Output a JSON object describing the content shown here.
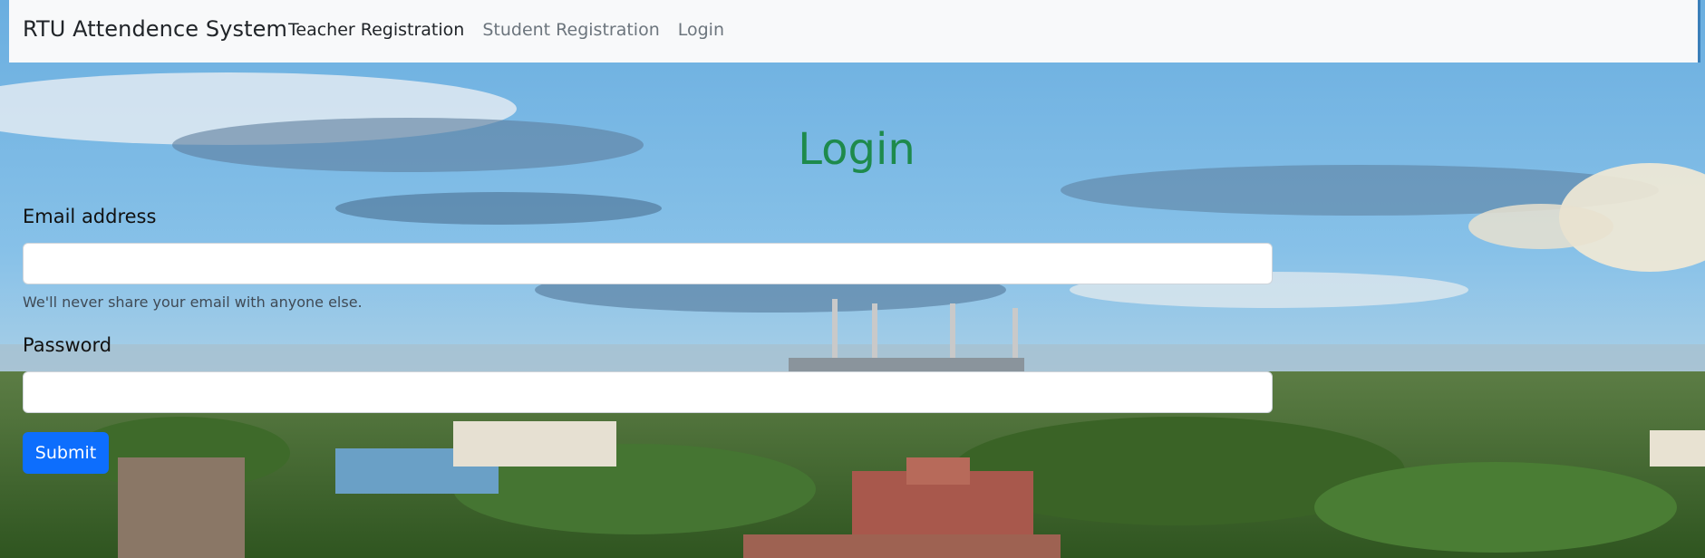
{
  "navbar": {
    "brand": "RTU Attendence System",
    "links": [
      {
        "label": "Teacher Registration",
        "active": true
      },
      {
        "label": "Student Registration",
        "active": false
      },
      {
        "label": "Login",
        "active": false
      }
    ]
  },
  "form": {
    "title": "Login",
    "email_label": "Email address",
    "email_value": "",
    "email_help": "We'll never share your email with anyone else.",
    "password_label": "Password",
    "password_value": "",
    "submit_label": "Submit"
  },
  "colors": {
    "title": "#1e8a4c",
    "submit": "#0d6efd",
    "navbar_bg": "#f8f9fa"
  }
}
